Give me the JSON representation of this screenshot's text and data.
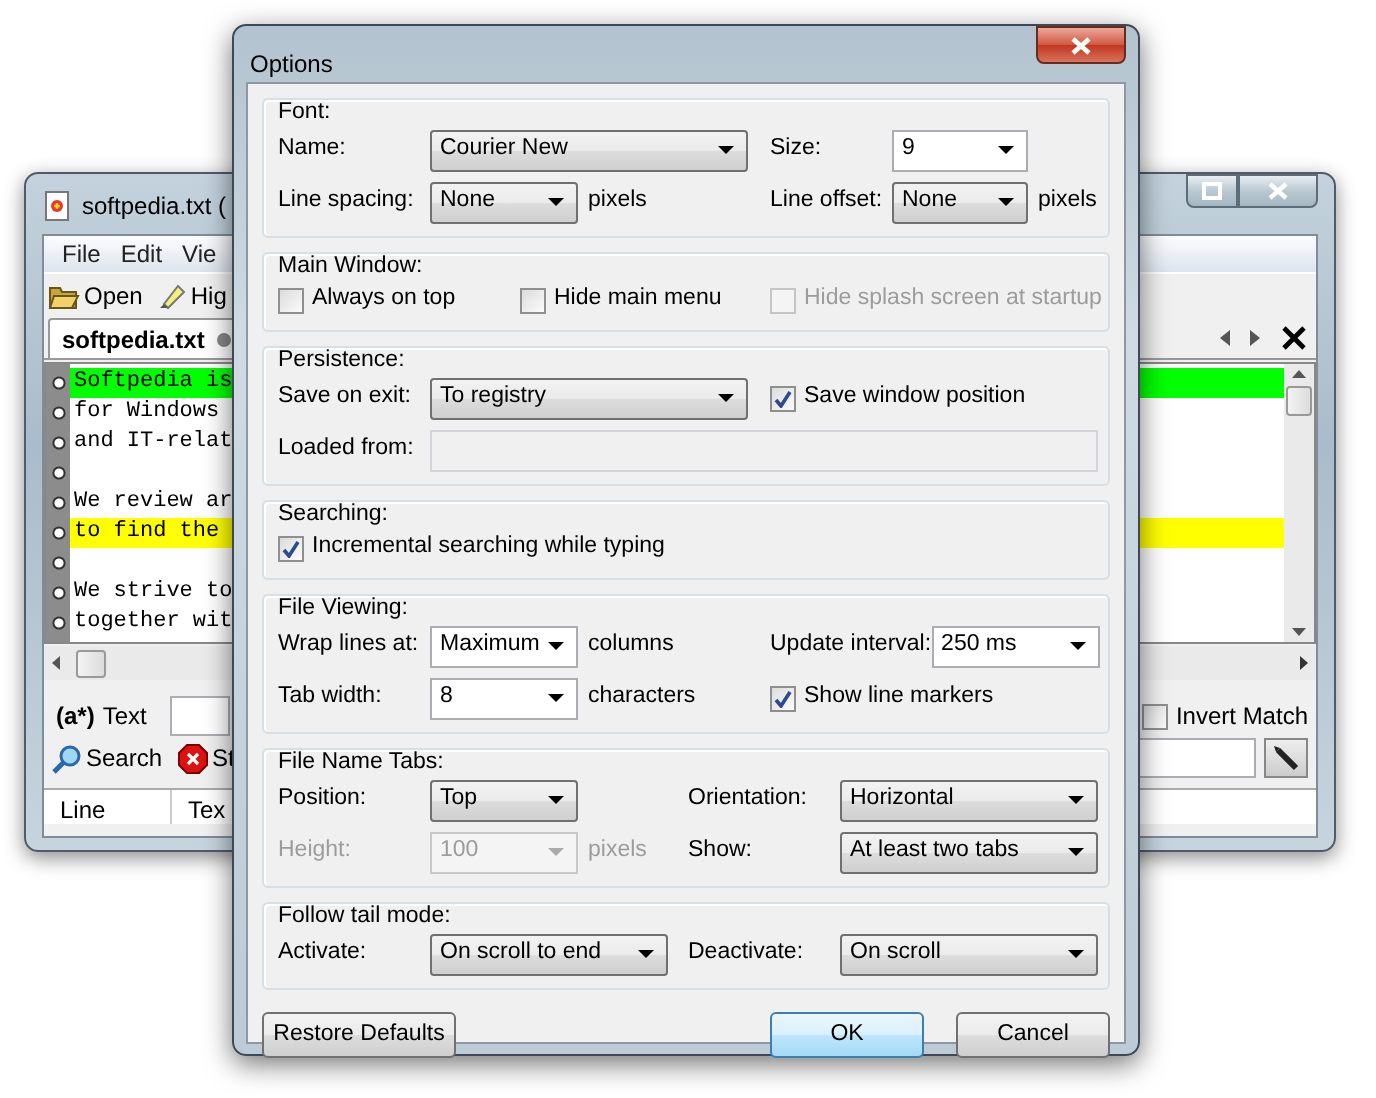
{
  "main_window": {
    "title": "softpedia.txt (",
    "menu": [
      "File",
      "Edit",
      "Vie"
    ],
    "toolbar": [
      {
        "label": "Open",
        "kind": "open"
      },
      {
        "label": "Hig",
        "kind": "highlight"
      }
    ],
    "tabs": [
      {
        "label": "softpedia.txt",
        "selected": true
      }
    ],
    "lines": [
      {
        "kind": "text",
        "text": "Softpedia is",
        "color": "#00ff00"
      },
      {
        "kind": "text",
        "text": "for Windows"
      },
      {
        "kind": "text",
        "text": "and IT-relat"
      },
      {
        "kind": "blank"
      },
      {
        "kind": "text",
        "text": "We review ar"
      },
      {
        "kind": "text",
        "text": "to find the",
        "color": "#ffff00"
      },
      {
        "kind": "blank"
      },
      {
        "kind": "text",
        "text": "We strive to"
      },
      {
        "kind": "text",
        "text": "together wit"
      }
    ],
    "search": {
      "regex_label": "(a*)",
      "label": "Text"
    },
    "invert_match": {
      "label": "Invert Match",
      "checked": false
    },
    "actions": [
      {
        "label": "Search",
        "kind": "search"
      },
      {
        "label": "St",
        "kind": "stop"
      }
    ],
    "columns": [
      "Line",
      "Tex"
    ]
  },
  "dialog": {
    "title": "Options",
    "groups": [
      {
        "title": "Font:",
        "rows": [
          [
            {
              "kind": "label",
              "text": "Name:",
              "disabled": false
            },
            {
              "kind": "select",
              "value": "Courier New",
              "editable": false,
              "disabled": false
            },
            "",
            {
              "kind": "label",
              "text": "Size:",
              "disabled": false
            },
            {
              "kind": "select",
              "value": "9",
              "editable": true,
              "disabled": false
            }
          ],
          [
            {
              "kind": "label",
              "text": "Line spacing:",
              "disabled": false
            },
            {
              "kind": "select",
              "value": "None",
              "editable": false,
              "disabled": false
            },
            {
              "kind": "label",
              "text": "pixels",
              "disabled": false
            },
            {
              "kind": "label",
              "text": "Line offset:",
              "disabled": false
            },
            {
              "kind": "select",
              "value": "None",
              "editable": false,
              "disabled": false
            },
            {
              "kind": "label",
              "text": "pixels",
              "disabled": false
            }
          ]
        ]
      },
      {
        "title": "Main Window:",
        "rows": [
          [
            {
              "kind": "checkbox",
              "text": "Always on top",
              "checked": false,
              "disabled": false
            },
            {
              "kind": "checkbox",
              "text": "Hide main menu",
              "checked": false,
              "disabled": false
            },
            {
              "kind": "checkbox",
              "text": "Hide splash screen at startup",
              "checked": false,
              "disabled": true
            }
          ]
        ]
      },
      {
        "title": "Persistence:",
        "rows": [
          [
            {
              "kind": "label",
              "text": "Save on exit:",
              "disabled": false
            },
            {
              "kind": "select",
              "value": "To registry",
              "editable": false,
              "disabled": false
            },
            {
              "kind": "checkbox",
              "text": "Save window position",
              "checked": true,
              "disabled": false
            }
          ],
          [
            {
              "kind": "label",
              "text": "Loaded from:",
              "disabled": false
            },
            {
              "kind": "field",
              "disabled": true
            }
          ]
        ]
      },
      {
        "title": "Searching:",
        "rows": [
          [
            {
              "kind": "checkbox",
              "text": "Incremental searching while typing",
              "checked": true,
              "disabled": false
            }
          ]
        ]
      },
      {
        "title": "File Viewing:",
        "rows": [
          [
            {
              "kind": "label",
              "text": "Wrap lines at:",
              "disabled": false
            },
            {
              "kind": "select",
              "value": "Maximum",
              "editable": true,
              "disabled": false
            },
            {
              "kind": "label",
              "text": "columns",
              "disabled": false
            },
            {
              "kind": "label",
              "text": "Update interval:",
              "disabled": false
            },
            {
              "kind": "select",
              "value": "250 ms",
              "editable": true,
              "disabled": false
            }
          ],
          [
            {
              "kind": "label",
              "text": "Tab width:",
              "disabled": false
            },
            {
              "kind": "select",
              "value": "8",
              "editable": true,
              "disabled": false
            },
            {
              "kind": "label",
              "text": "characters",
              "disabled": false
            },
            {
              "kind": "checkbox",
              "text": "Show line markers",
              "checked": true,
              "disabled": false
            }
          ]
        ]
      },
      {
        "title": "File Name Tabs:",
        "rows": [
          [
            {
              "kind": "label",
              "text": "Position:",
              "disabled": false
            },
            {
              "kind": "select",
              "value": "Top",
              "editable": false,
              "disabled": false
            },
            "",
            {
              "kind": "label",
              "text": "Orientation:",
              "disabled": false
            },
            {
              "kind": "select",
              "value": "Horizontal",
              "editable": false,
              "disabled": false
            }
          ],
          [
            {
              "kind": "label",
              "text": "Height:",
              "disabled": true
            },
            {
              "kind": "select",
              "value": "100",
              "editable": true,
              "disabled": true
            },
            {
              "kind": "label",
              "text": "pixels",
              "disabled": true
            },
            {
              "kind": "label",
              "text": "Show:",
              "disabled": false
            },
            {
              "kind": "select",
              "value": "At least two tabs",
              "editable": false,
              "disabled": false
            }
          ]
        ]
      },
      {
        "title": "Follow tail mode:",
        "rows": [
          [
            {
              "kind": "label",
              "text": "Activate:",
              "disabled": false
            },
            {
              "kind": "select",
              "value": "On scroll to end",
              "editable": false,
              "disabled": false
            },
            {
              "kind": "label",
              "text": "Deactivate:",
              "disabled": false
            },
            {
              "kind": "select",
              "value": "On scroll",
              "editable": false,
              "disabled": false
            }
          ]
        ]
      }
    ],
    "buttons": [
      {
        "label": "Restore Defaults",
        "default": false
      },
      {
        "label": "OK",
        "default": true
      },
      {
        "label": "Cancel",
        "default": false
      }
    ]
  }
}
